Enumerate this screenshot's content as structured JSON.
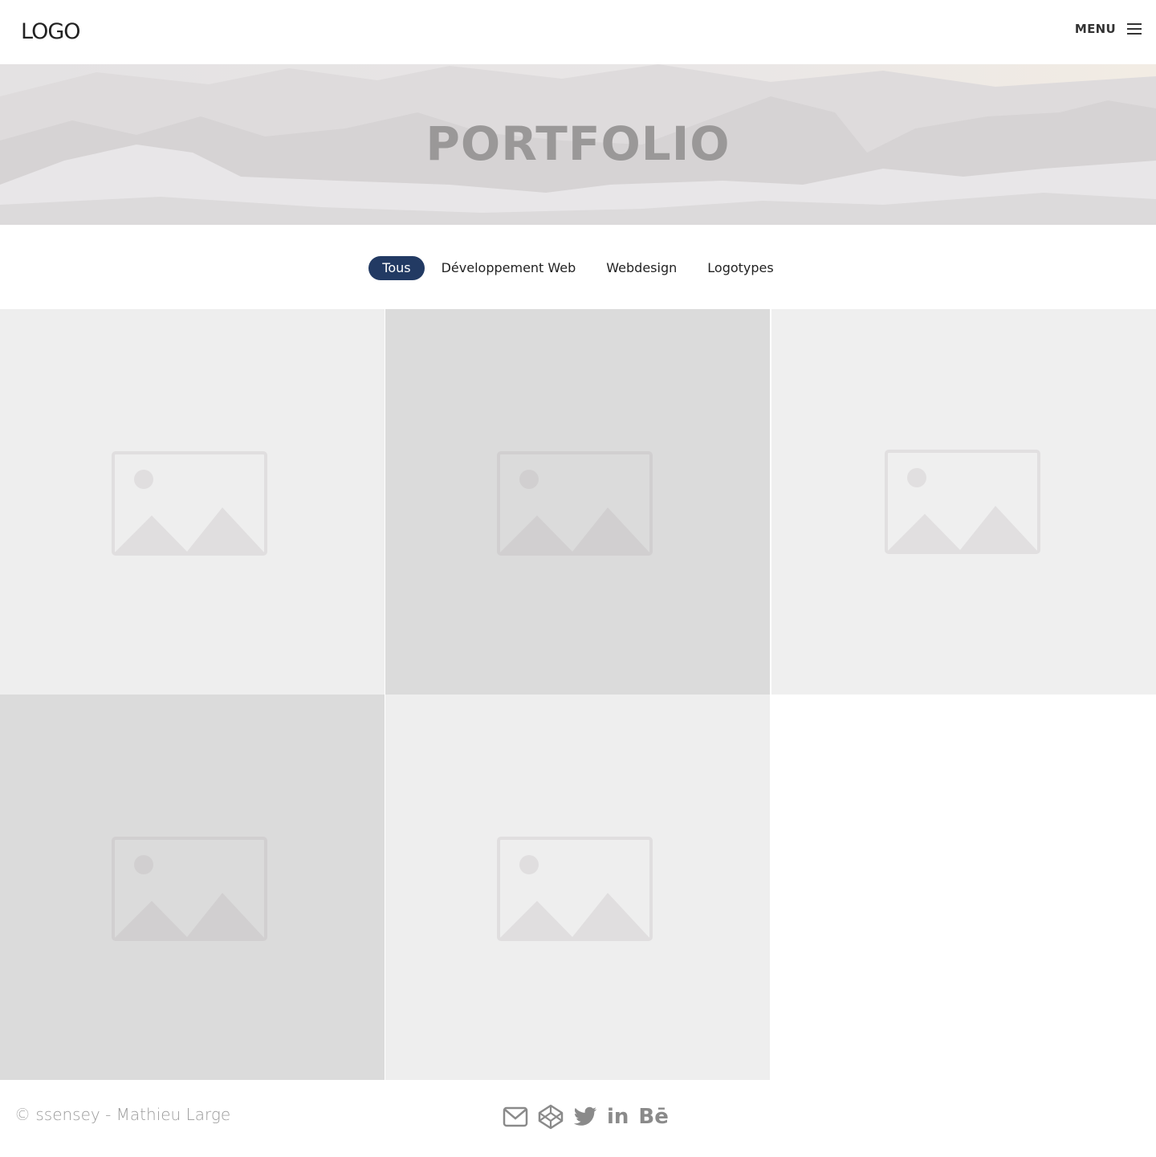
{
  "header": {
    "logo": "LOGO",
    "menu_label": "MENU",
    "menu_icon": "hamburger-icon"
  },
  "hero": {
    "title": "PORTFOLIO"
  },
  "filters": [
    {
      "label": "Tous",
      "active": true
    },
    {
      "label": "Développement Web",
      "active": false
    },
    {
      "label": "Webdesign",
      "active": false
    },
    {
      "label": "Logotypes",
      "active": false
    }
  ],
  "portfolio_items": [
    {
      "icon": "image-placeholder-icon",
      "bg": "#eeeeee"
    },
    {
      "icon": "image-placeholder-icon",
      "bg": "#dbdbdb"
    },
    {
      "icon": "image-placeholder-icon",
      "bg": "#efefef"
    },
    {
      "icon": "image-placeholder-icon",
      "bg": "#dbdbdb"
    },
    {
      "icon": "image-placeholder-icon",
      "bg": "#eeeeee"
    }
  ],
  "footer": {
    "copyright": "© ssensey - Mathieu Large",
    "socials": [
      {
        "name": "email-icon"
      },
      {
        "name": "codepen-icon"
      },
      {
        "name": "twitter-icon"
      },
      {
        "name": "linkedin-icon",
        "text": "in"
      },
      {
        "name": "behance-icon",
        "text": "Bē"
      }
    ]
  },
  "colors": {
    "accent": "#223a63",
    "title_gray": "#9a9898",
    "icon_gray": "#8a8a8a"
  }
}
